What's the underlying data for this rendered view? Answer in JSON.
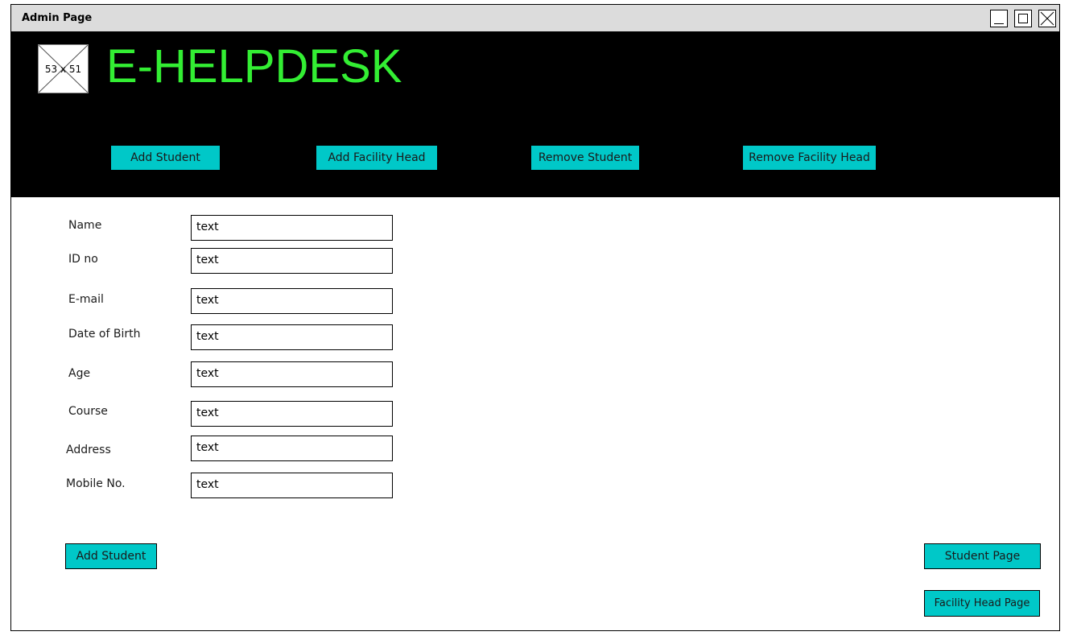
{
  "window": {
    "title": "Admin Page"
  },
  "header": {
    "logo_placeholder": "53 x 51",
    "brand": "E-HELPDESK",
    "nav": [
      {
        "label": "Add Student"
      },
      {
        "label": "Add Facility Head"
      },
      {
        "label": "Remove Student"
      },
      {
        "label": "Remove Facility Head"
      }
    ]
  },
  "form": {
    "fields": [
      {
        "label": "Name",
        "value": "text"
      },
      {
        "label": "ID no",
        "value": "text"
      },
      {
        "label": "E-mail",
        "value": "text"
      },
      {
        "label": "Date of Birth",
        "value": "text"
      },
      {
        "label": "Age",
        "value": "text"
      },
      {
        "label": "Course",
        "value": "text"
      },
      {
        "label": "Address",
        "value": "text"
      },
      {
        "label": "Mobile No.",
        "value": "text"
      }
    ],
    "submit_label": "Add Student"
  },
  "side_actions": {
    "student_page": "Student Page",
    "facility_head_page": "Facility Head Page"
  },
  "colors": {
    "header_bg": "#000000",
    "brand": "#33ee33",
    "button": "#00c8c8",
    "titlebar": "#dcdcdc"
  }
}
